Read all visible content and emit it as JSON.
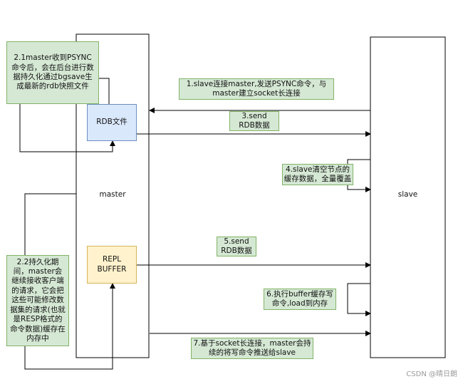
{
  "lifelines": {
    "master": "master",
    "slave": "slave"
  },
  "boxes": {
    "rdb_file": "RDB文件",
    "repl_buffer": "REPL\nBUFFER"
  },
  "notes": {
    "bgsave": "2.1master收到PSYNC命令后，会在后台进行数据持久化通过bgsave生成最新的rdb快照文件",
    "buffering": "2.2持久化期间，master会继续接收客户端的请求，它会把这些可能修改数据集的请求(也就是RESP格式的命令数据)缓存在内存中"
  },
  "messages": {
    "psync": "1.slave连接master,发送PSYNC命令，与master建立socket长连接",
    "send_rdb": "3.send\nRDB数据",
    "flush_load": "4.slave清空节点的缓存数据，全量覆盖",
    "send_rdb2": "5.send\nRDB数据",
    "exec_buffer": "6.执行buffer缓存写命令,load到内存",
    "stream": "7.基于socket长连接，master会持续的将写命令推送给slave"
  },
  "watermark": "CSDN @晴日朗"
}
